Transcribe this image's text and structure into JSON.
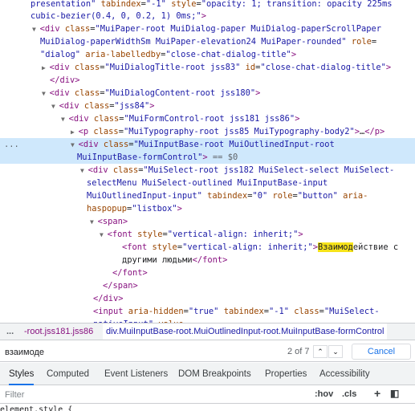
{
  "elements_tree": {
    "lines": [
      {
        "segments": [
          [
            "av",
            "presentation\""
          ],
          [
            "an",
            " tabindex"
          ],
          [
            "tx",
            "="
          ],
          [
            "av",
            "\"-1\""
          ],
          [
            "an",
            " style"
          ],
          [
            "tx",
            "="
          ],
          [
            "av",
            "\"opacity: 1; transition: opacity 225ms"
          ]
        ]
      },
      {
        "segments": [
          [
            "av",
            "cubic-bezier(0.4, 0, 0.2, 1) 0ms;\""
          ],
          [
            "tag",
            ">"
          ]
        ]
      },
      {
        "segments": [
          [
            "arrow",
            "▼"
          ],
          [
            "tag",
            "<div"
          ],
          [
            "an",
            " class"
          ],
          [
            "tx",
            "="
          ],
          [
            "av",
            "\"MuiPaper-root MuiDialog-paper MuiDialog-paperScrollPaper"
          ]
        ]
      },
      {
        "segments": [
          [
            "av",
            "MuiDialog-paperWidthSm MuiPaper-elevation24 MuiPaper-rounded\""
          ],
          [
            "an",
            " role"
          ],
          [
            "tx",
            "="
          ]
        ]
      },
      {
        "segments": [
          [
            "av",
            "\"dialog\""
          ],
          [
            "an",
            " aria-labelledby"
          ],
          [
            "tx",
            "="
          ],
          [
            "av",
            "\"close-chat-dialog-title\""
          ],
          [
            "tag",
            ">"
          ]
        ]
      },
      {
        "segments": [
          [
            "arrow",
            "▶"
          ],
          [
            "tag",
            "<div"
          ],
          [
            "an",
            " class"
          ],
          [
            "tx",
            "="
          ],
          [
            "av",
            "\"MuiDialogTitle-root jss83\""
          ],
          [
            "an",
            " id"
          ],
          [
            "tx",
            "="
          ],
          [
            "av",
            "\"close-chat-dialog-title\""
          ],
          [
            "tag",
            ">"
          ]
        ]
      },
      {
        "segments": [
          [
            "tag",
            "</div>"
          ]
        ]
      },
      {
        "segments": [
          [
            "arrow",
            "▼"
          ],
          [
            "tag",
            "<div"
          ],
          [
            "an",
            " class"
          ],
          [
            "tx",
            "="
          ],
          [
            "av",
            "\"MuiDialogContent-root jss180\""
          ],
          [
            "tag",
            ">"
          ]
        ]
      },
      {
        "segments": [
          [
            "arrow",
            "▼"
          ],
          [
            "tag",
            "<div"
          ],
          [
            "an",
            " class"
          ],
          [
            "tx",
            "="
          ],
          [
            "av",
            "\"jss84\""
          ],
          [
            "tag",
            ">"
          ]
        ]
      },
      {
        "segments": [
          [
            "arrow",
            "▼"
          ],
          [
            "tag",
            "<div"
          ],
          [
            "an",
            " class"
          ],
          [
            "tx",
            "="
          ],
          [
            "av",
            "\"MuiFormControl-root jss181 jss86\""
          ],
          [
            "tag",
            ">"
          ]
        ]
      },
      {
        "segments": [
          [
            "arrow",
            "▶"
          ],
          [
            "tag",
            "<p"
          ],
          [
            "an",
            " class"
          ],
          [
            "tx",
            "="
          ],
          [
            "av",
            "\"MuiTypography-root jss85 MuiTypography-body2\""
          ],
          [
            "tag",
            ">"
          ],
          [
            "tx",
            "…"
          ],
          [
            "tag",
            "</p>"
          ]
        ]
      },
      {
        "segments": [
          [
            "arrow",
            "▼"
          ],
          [
            "tag",
            "<div"
          ],
          [
            "an",
            " class"
          ],
          [
            "tx",
            "="
          ],
          [
            "av",
            "\"MuiInputBase-root MuiOutlinedInput-root"
          ]
        ]
      },
      {
        "segments": [
          [
            "av",
            "MuiInputBase-formControl\""
          ],
          [
            "tag",
            ">"
          ],
          [
            "eq0",
            " == $0"
          ]
        ]
      },
      {
        "segments": [
          [
            "arrow",
            "▼"
          ],
          [
            "tag",
            "<div"
          ],
          [
            "an",
            " class"
          ],
          [
            "tx",
            "="
          ],
          [
            "av",
            "\"MuiSelect-root jss182 MuiSelect-select MuiSelect-"
          ]
        ]
      },
      {
        "segments": [
          [
            "av",
            "selectMenu MuiSelect-outlined MuiInputBase-input"
          ]
        ]
      },
      {
        "segments": [
          [
            "av",
            "MuiOutlinedInput-input\""
          ],
          [
            "an",
            " tabindex"
          ],
          [
            "tx",
            "="
          ],
          [
            "av",
            "\"0\""
          ],
          [
            "an",
            " role"
          ],
          [
            "tx",
            "="
          ],
          [
            "av",
            "\"button\""
          ],
          [
            "an",
            " aria-"
          ]
        ]
      },
      {
        "segments": [
          [
            "an",
            "haspopup"
          ],
          [
            "tx",
            "="
          ],
          [
            "av",
            "\"listbox\""
          ],
          [
            "tag",
            ">"
          ]
        ]
      },
      {
        "segments": [
          [
            "arrow",
            "▼"
          ],
          [
            "tag",
            "<span>"
          ]
        ]
      },
      {
        "segments": [
          [
            "arrow",
            "▼"
          ],
          [
            "tag",
            "<font"
          ],
          [
            "an",
            " style"
          ],
          [
            "tx",
            "="
          ],
          [
            "av",
            "\"vertical-align: inherit;\""
          ],
          [
            "tag",
            ">"
          ]
        ]
      },
      {
        "segments": [
          [
            "tag",
            "<font"
          ],
          [
            "an",
            " style"
          ],
          [
            "tx",
            "="
          ],
          [
            "av",
            "\"vertical-align: inherit;\""
          ],
          [
            "tag",
            ">"
          ],
          [
            "hl",
            "Взаимод"
          ],
          [
            "tw",
            "ействие с"
          ]
        ]
      },
      {
        "segments": [
          [
            "tw",
            "другими людьми"
          ],
          [
            "tag",
            "</font>"
          ]
        ]
      },
      {
        "segments": [
          [
            "tag",
            "</font>"
          ]
        ]
      },
      {
        "segments": [
          [
            "tag",
            "</span>"
          ]
        ]
      },
      {
        "segments": [
          [
            "tag",
            "</div>"
          ]
        ]
      },
      {
        "segments": [
          [
            "tag",
            "<input"
          ],
          [
            "an",
            " aria-hidden"
          ],
          [
            "tx",
            "="
          ],
          [
            "av",
            "\"true\""
          ],
          [
            "an",
            " tabindex"
          ],
          [
            "tx",
            "="
          ],
          [
            "av",
            "\"-1\""
          ],
          [
            "an",
            " class"
          ],
          [
            "tx",
            "="
          ],
          [
            "av",
            "\"MuiSelect-"
          ]
        ]
      },
      {
        "segments": [
          [
            "av",
            "nativeInput\""
          ],
          [
            "an",
            " value"
          ],
          [
            "tx",
            "="
          ]
        ]
      }
    ],
    "selected_ellipsis": "..."
  },
  "breadcrumb": {
    "ellipsis": "...",
    "crumb_prev": "-root.jss181.jss86",
    "crumb_current": "div.MuiInputBase-root.MuiOutlinedInput-root.MuiInputBase-formControl"
  },
  "search": {
    "value": "взаимоде",
    "match_count": "2 of 7",
    "prev_glyph": "⌃",
    "next_glyph": "⌄",
    "cancel_label": "Cancel"
  },
  "tabs": [
    "Styles",
    "Computed",
    "Event Listeners",
    "DOM Breakpoints",
    "Properties",
    "Accessibility"
  ],
  "active_tab": "Styles",
  "filter": {
    "placeholder": "Filter",
    "hov_label": ":hov",
    "cls_label": ".cls",
    "add_label": "+",
    "toggle_label": "◧"
  },
  "element_style_label": "element.style {"
}
